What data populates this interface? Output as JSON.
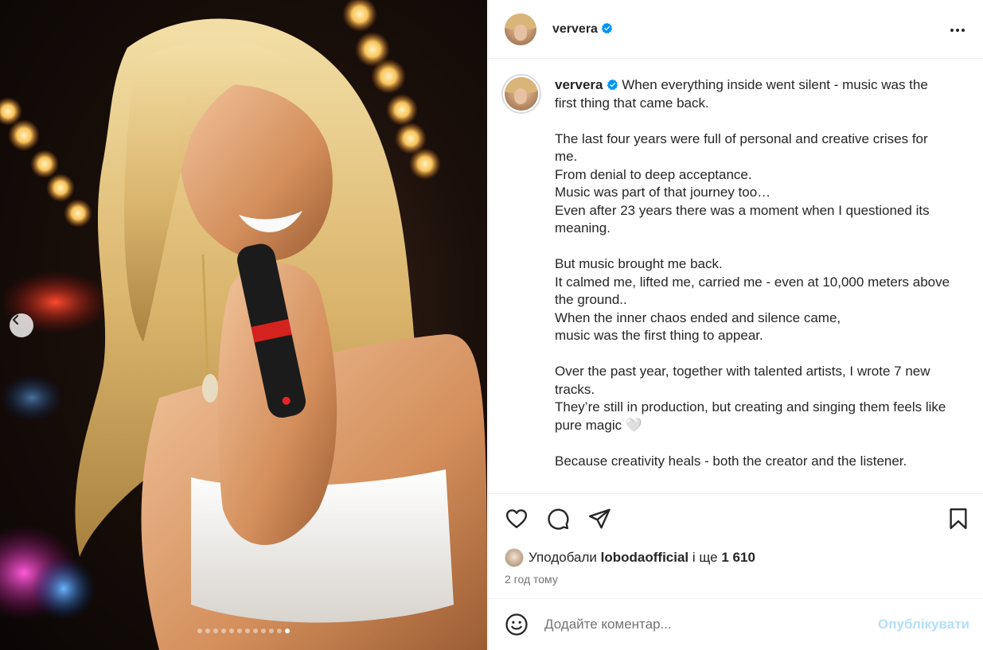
{
  "colors": {
    "verified_blue": "#0095f6",
    "text_primary": "#262626",
    "text_secondary": "#737373",
    "publish_disabled": "#b2dffc",
    "divider": "#efefef"
  },
  "media": {
    "carousel": {
      "total_slides": 12,
      "active_slide": 12
    },
    "prev_icon": "chevron-left-icon"
  },
  "header": {
    "username": "ververa",
    "verified_icon": "verified-badge-icon",
    "more_icon": "more-horizontal-icon"
  },
  "caption": {
    "username": "ververa",
    "paragraphs": [
      [
        "When everything inside went silent - music was the first thing that came back."
      ],
      [
        "The last four years were full of personal and creative crises for me.",
        "From denial to deep acceptance.",
        "Music was part of that journey too…",
        "Even after 23 years there was a moment when I questioned its meaning."
      ],
      [
        "But music brought me back.",
        "It calmed me, lifted me, carried me - even at 10,000 meters above the ground..",
        "When the inner chaos ended and silence came,",
        "music was the first thing to appear."
      ],
      [
        "Over the past year, together with talented artists, I wrote 7 new tracks.",
        "They’re still in production, but creating and singing them feels like pure magic 🤍"
      ],
      [
        "Because creativity heals - both the creator and the listener."
      ]
    ]
  },
  "actions": {
    "like_icon": "heart-icon",
    "comment_icon": "comment-icon",
    "share_icon": "share-icon",
    "save_icon": "bookmark-icon",
    "liked_by_prefix": "Уподобали",
    "liked_by_user": "lobodaofficial",
    "liked_by_suffix": "і ще 1 610",
    "time_ago": "2 год тому"
  },
  "comment": {
    "emoji_icon": "smiley-icon",
    "placeholder": "Додайте коментар...",
    "publish_label": "Опублікувати"
  }
}
